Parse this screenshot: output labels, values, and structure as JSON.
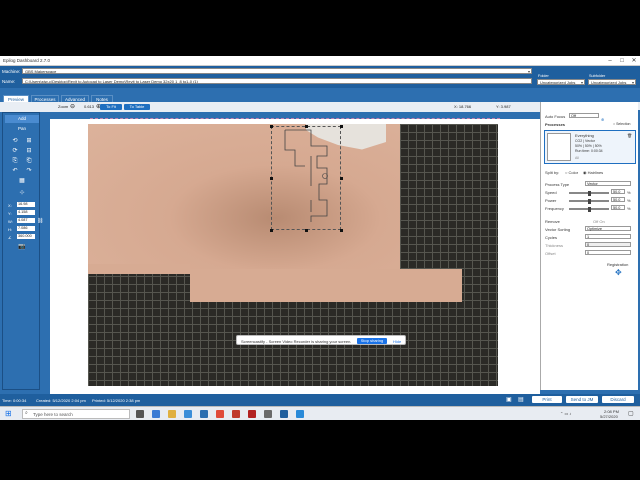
{
  "app": {
    "title": "Epilog Dashboard 2.7.0",
    "machine_label": "Machine:",
    "machine_value": "GBS Makerspace",
    "name_label": "Name:",
    "name_value": "C:\\Users\\stw-c\\Desktop\\Revit to Autocad to Laser Demo\\Revit to Laser Demo 32x20 1_8 to1-0 (1)",
    "folder_label": "Folder",
    "folder_value": "Uncategorized Jobs",
    "subfolder_label": "Subfolder",
    "subfolder_value": "Uncategorized Jobs"
  },
  "tabs": [
    {
      "label": "Preview"
    },
    {
      "label": "Processes"
    },
    {
      "label": "Advanced"
    },
    {
      "label": "Notes"
    }
  ],
  "toolbar": {
    "zoom_label": "Zoom",
    "zoom_value": "0.613",
    "to_fit": "To Fit",
    "to_table": "To Table",
    "x_readout": "X: 18.766",
    "y_readout": "Y: 3.987",
    "view_label": "View",
    "view_options": [
      "Combined",
      "Engrave",
      "Vector"
    ]
  },
  "leftpanel": {
    "add": "Add",
    "pan": "Pan",
    "coords": [
      {
        "label": "X:",
        "value": "16.98"
      },
      {
        "label": "Y:",
        "value": "4.158"
      },
      {
        "label": "W:",
        "value": "4.087"
      },
      {
        "label": "H:",
        "value": "7.086"
      },
      {
        "label": "∠",
        "value": "360.000"
      }
    ]
  },
  "rightpanel": {
    "auto_focus_label": "Auto Focus",
    "auto_focus_value": "Off",
    "processes_label": "Processes",
    "selection_label": "Selection",
    "process_name": "Everything",
    "process_line1": "CO2 | Vector",
    "process_line2": "50% | 50% | 50%",
    "process_line3": "Run time: 0:00:34",
    "process_all": "All",
    "split_by_label": "Split by:",
    "split_color": "Color",
    "split_hairlines": "Hairlines",
    "process_type_label": "Process Type",
    "process_type_value": "Vector",
    "speed_label": "Speed",
    "speed_value": "50.0",
    "power_label": "Power",
    "power_value": "50.0",
    "frequency_label": "Frequency",
    "frequency_value": "50.0",
    "pct": "%",
    "remove_label": "Remove",
    "off_on": "Off     On",
    "vector_sorting_label": "Vector Sorting",
    "vector_sorting_value": "Optimize",
    "cycles_label": "Cycles",
    "cycles_value": "1",
    "thickness_label": "Thickness",
    "thickness_value": "0",
    "offset_label": "Offset",
    "offset_value": "0",
    "registration_label": "Registration"
  },
  "status": {
    "time": "Time: 0:00:34",
    "created": "Created: 5/12/2020 2:04 pm",
    "printed": "Printed: 5/12/2020 2:38 pm",
    "print": "Print",
    "send_to_jm": "Send to JM",
    "discard": "Discard"
  },
  "share_bar": {
    "text": "Screencastify - Screen Video Recorder is sharing your screen.",
    "stop": "Stop sharing",
    "hide": "Hide"
  },
  "taskbar": {
    "search_placeholder": "Type here to search",
    "time": "2:08 PM",
    "date": "5/27/2020"
  }
}
